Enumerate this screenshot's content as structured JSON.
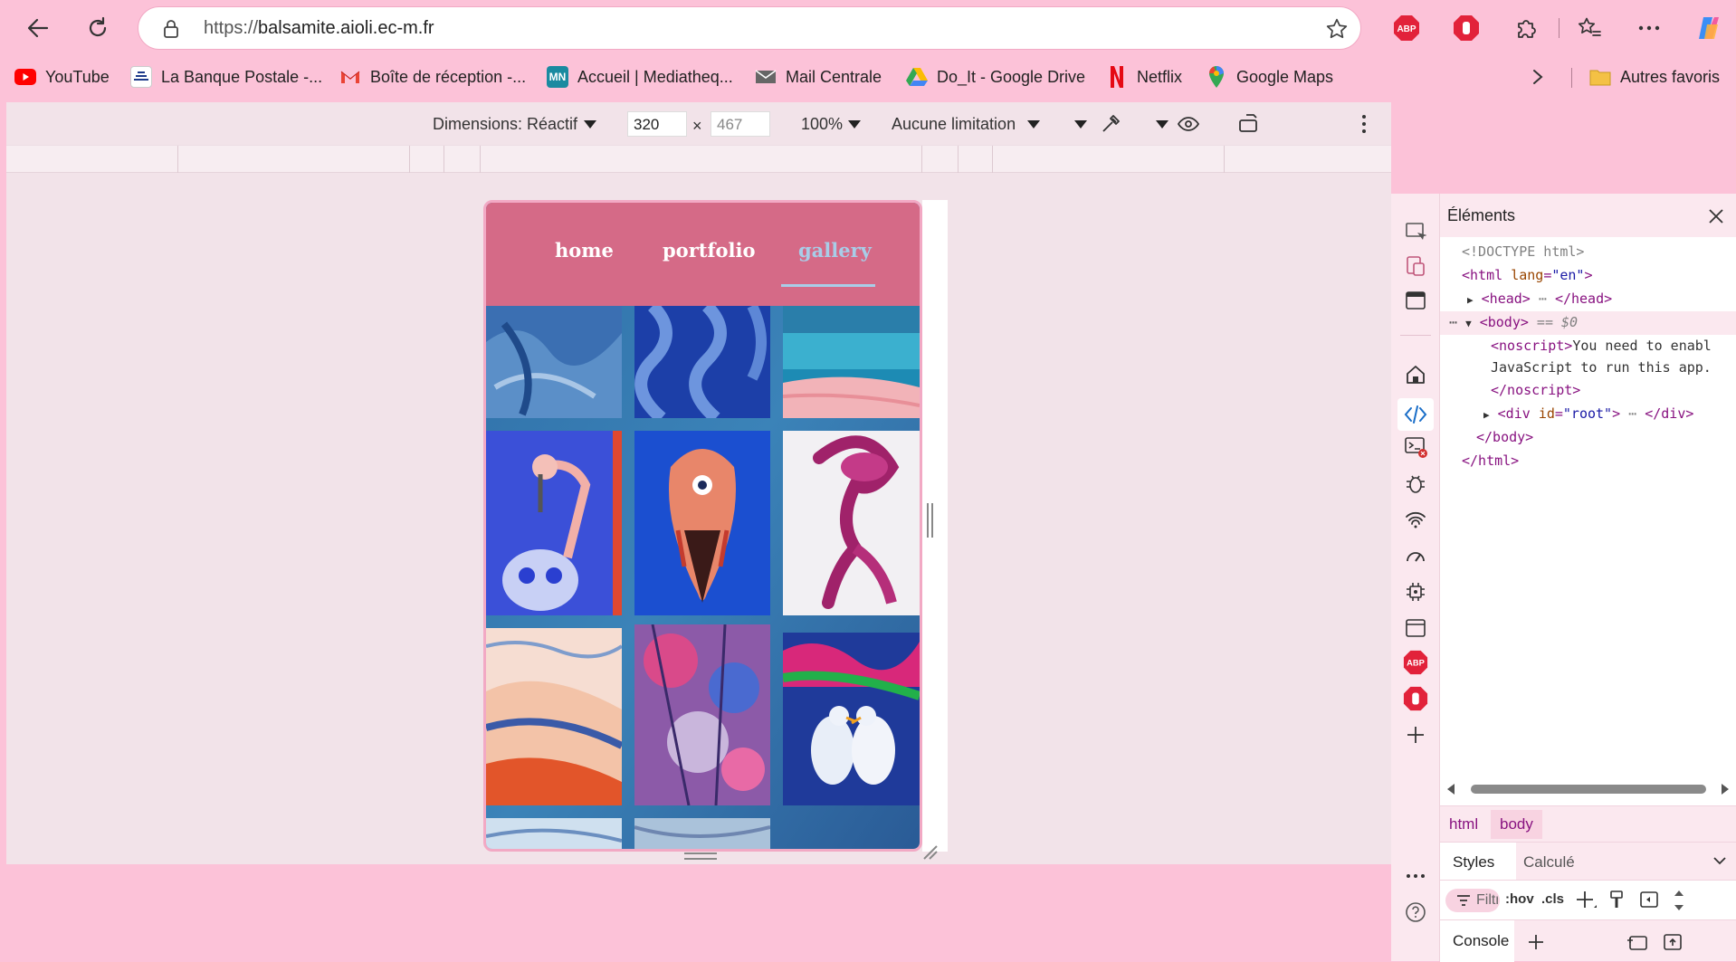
{
  "browser": {
    "url_prefix": "https://",
    "url_host": "balsamite.aioli.ec-m.fr",
    "extensions": [
      "adblock-plus-icon",
      "ublock-icon",
      "puzzle-icon"
    ]
  },
  "bookmarks": [
    {
      "label": "YouTube",
      "icon": "youtube-icon",
      "color": "#ff0000"
    },
    {
      "label": "La Banque Postale -...",
      "icon": "banque-postale-icon",
      "color": "#1e3a8a"
    },
    {
      "label": "Boîte de réception -...",
      "icon": "gmail-icon",
      "color": "#ea4335"
    },
    {
      "label": "Accueil | Mediatheq...",
      "icon": "mn-icon",
      "color": "#1a8aa0",
      "badge": "MN"
    },
    {
      "label": "Mail Centrale",
      "icon": "mail-icon",
      "color": "#555555"
    },
    {
      "label": "Do_It - Google Drive",
      "icon": "google-drive-icon",
      "color": "#34a853"
    },
    {
      "label": "Netflix",
      "icon": "netflix-icon",
      "color": "#e50914"
    },
    {
      "label": "Google Maps",
      "icon": "google-maps-icon",
      "color": "#4285f4"
    }
  ],
  "bookmarks_other": "Autres favoris",
  "device_toolbar": {
    "dimensions_label": "Dimensions: Réactif",
    "width": "320",
    "times": "×",
    "height": "467",
    "zoom": "100%",
    "throttle": "Aucune limitation"
  },
  "site": {
    "nav": [
      {
        "label": "home",
        "active": false
      },
      {
        "label": "portfolio",
        "active": false
      },
      {
        "label": "gallery",
        "active": true
      }
    ],
    "accent": "#d56a87",
    "active_color": "#a8cde8"
  },
  "devtools": {
    "title": "Éléments",
    "code": [
      {
        "indent": 0,
        "parts": [
          [
            "cmt",
            "<!DOCTYPE html>"
          ]
        ]
      },
      {
        "indent": 0,
        "parts": [
          [
            "tag",
            "<html "
          ],
          [
            "attr",
            "lang"
          ],
          [
            "tag",
            "="
          ],
          [
            "val",
            "\"en\""
          ],
          [
            "tag",
            ">"
          ]
        ]
      },
      {
        "indent": 1,
        "arrow": "▶",
        "parts": [
          [
            "tag",
            "<head>"
          ],
          [
            "cmt",
            " ⋯ "
          ],
          [
            "tag",
            "</head>"
          ]
        ]
      },
      {
        "indent": 1,
        "arrow": "▼",
        "selected": true,
        "parts": [
          [
            "tag",
            "<body>"
          ],
          [
            "cmt",
            " == $0"
          ]
        ]
      },
      {
        "indent": 2,
        "parts": [
          [
            "tag",
            "<noscript>"
          ],
          [
            "txt",
            "You need to enabl"
          ]
        ]
      },
      {
        "indent": 2,
        "parts": [
          [
            "txt",
            "JavaScript to run this app."
          ]
        ]
      },
      {
        "indent": 2,
        "parts": [
          [
            "tag",
            "</noscript>"
          ]
        ]
      },
      {
        "indent": 2,
        "arrow": "▶",
        "parts": [
          [
            "tag",
            "<div "
          ],
          [
            "attr",
            "id"
          ],
          [
            "tag",
            "="
          ],
          [
            "val",
            "\"root\""
          ],
          [
            "tag",
            ">"
          ],
          [
            "cmt",
            " ⋯ "
          ],
          [
            "tag",
            "</div>"
          ]
        ]
      },
      {
        "indent": 1,
        "parts": [
          [
            "tag",
            "</body>"
          ]
        ]
      },
      {
        "indent": 0,
        "parts": [
          [
            "tag",
            "</html>"
          ]
        ]
      }
    ],
    "crumbs": [
      "html",
      "body"
    ],
    "tabs": [
      "Styles",
      "Calculé"
    ],
    "filter_placeholder": "Filtr",
    "hov": ":hov",
    "cls": ".cls",
    "console": "Console"
  }
}
